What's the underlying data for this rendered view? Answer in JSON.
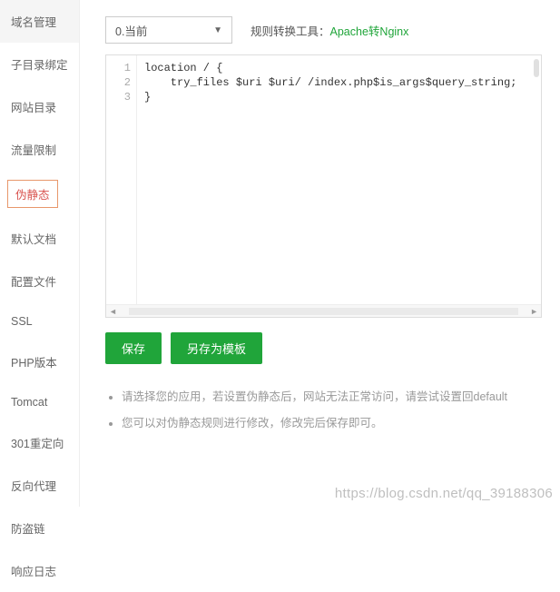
{
  "sidebar": {
    "items": [
      {
        "label": "域名管理"
      },
      {
        "label": "子目录绑定"
      },
      {
        "label": "网站目录"
      },
      {
        "label": "流量限制"
      },
      {
        "label": "伪静态",
        "active": true
      },
      {
        "label": "默认文档"
      },
      {
        "label": "配置文件"
      },
      {
        "label": "SSL"
      },
      {
        "label": "PHP版本"
      },
      {
        "label": "Tomcat"
      },
      {
        "label": "301重定向"
      },
      {
        "label": "反向代理"
      },
      {
        "label": "防盗链"
      },
      {
        "label": "响应日志"
      }
    ]
  },
  "dropdown": {
    "selected": "0.当前"
  },
  "tool": {
    "label": "规则转换工具：",
    "link": "Apache转Nginx"
  },
  "editor": {
    "lines": [
      "1",
      "2",
      "3"
    ],
    "code": "location / {\n    try_files $uri $uri/ /index.php$is_args$query_string;\n}"
  },
  "buttons": {
    "save": "保存",
    "save_tpl": "另存为模板"
  },
  "tips": {
    "t1": "请选择您的应用，若设置伪静态后，网站无法正常访问，请尝试设置回default",
    "t2": "您可以对伪静态规则进行修改，修改完后保存即可。"
  },
  "watermark": "https://blog.csdn.net/qq_39188306"
}
